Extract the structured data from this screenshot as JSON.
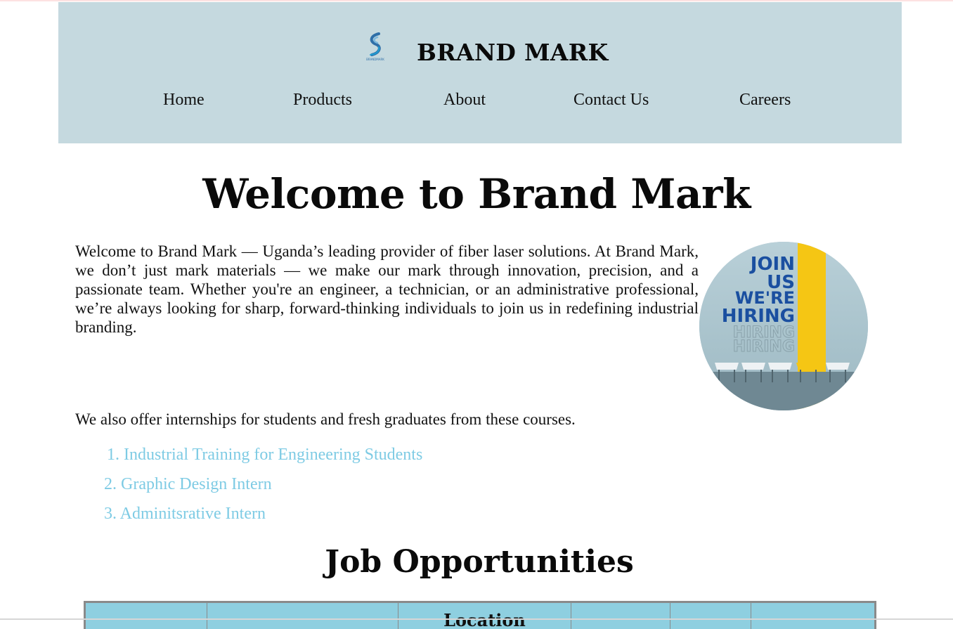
{
  "header": {
    "brand_title": "BRAND MARK",
    "logo_caption": "BRANDMARK",
    "nav": [
      {
        "label": "Home"
      },
      {
        "label": "Products"
      },
      {
        "label": "About"
      },
      {
        "label": "Contact Us"
      },
      {
        "label": "Careers"
      }
    ],
    "background_color": "#c5d9df"
  },
  "main": {
    "title": "Welcome to Brand Mark",
    "intro": "Welcome to Brand Mark — Uganda’s leading provider of fiber laser solutions. At Brand Mark, we don’t just mark materials — we make our mark through innovation, precision, and a passionate team. Whether you're an engineer, a technician, or an administrative professional, we’re always looking for sharp, forward-thinking individuals to join us in redefining industrial branding.",
    "hiring_image": {
      "lines": [
        "JOIN",
        "US",
        "WE'RE",
        "HIRING"
      ],
      "echo": "HIRING"
    },
    "internship_intro": "We also offer internships for students and fresh graduates from these courses.",
    "courses": [
      "1. Industrial Training for Engineering Students",
      "2. Graphic Design Intern",
      "3. Adminitsrative Intern"
    ],
    "link_color": "#7ecbe4",
    "jobs_title": "Job Opportunities",
    "jobs_table": {
      "headers": [
        "",
        "",
        "Location",
        "",
        "",
        ""
      ],
      "header_color": "#8ecfe0"
    }
  }
}
